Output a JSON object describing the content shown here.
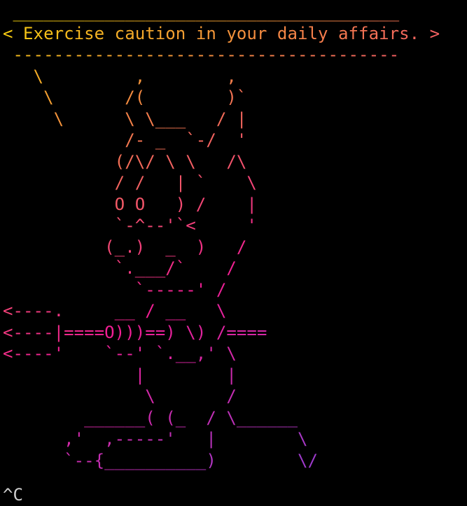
{
  "terminal": {
    "caret_line": "^C",
    "lines": [
      " ______________________________________",
      "< Exercise caution in your daily affairs. >",
      " --------------------------------------",
      "   \\         ,        ,",
      "    \\       /(        )`",
      "     \\      \\ \\___   / |",
      "            /- _  `-/  '",
      "           (/\\/ \\ \\   /\\",
      "           / /   | `    \\",
      "           O O   ) /    |",
      "           `-^--'`<     '",
      "          (_.)  _  )   /",
      "           `.___/`    /",
      "             `-----' /",
      "<----.     __ / __   \\",
      "<----|====O)))==) \\) /====",
      "<----'    `--' `.__,' \\",
      "             |        |",
      "              \\       /",
      "        ______( (_  / \\______",
      "      ,'  ,-----'   |        \\",
      "      `--{__________)        \\/"
    ]
  },
  "colors": {
    "background": "#000000",
    "gradient_top": "#f5d30a",
    "gradient_mid": "#f21e94",
    "gradient_bottom": "#6a4df0"
  }
}
